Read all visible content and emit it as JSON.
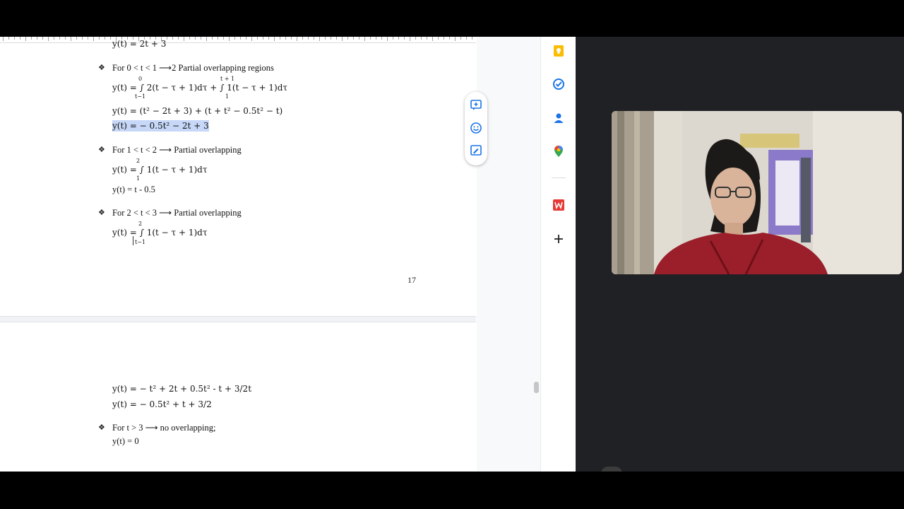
{
  "page1": {
    "top_line": "y(t) = 2t + 3",
    "bullet1": {
      "heading": "For 0 < t < 1 ⟶2  Partial overlapping regions",
      "eq1": "y(t) = ∫ 2(t − τ + 1)dτ + ∫ 1(t − τ + 1)dτ",
      "eq1_upper1": "0",
      "eq1_lower1": "t−1",
      "eq1_upper2": "t + 1",
      "eq1_lower2": "1",
      "eq2": "y(t) = (t² − 2t + 3) + (t + t² − 0.5t² − t)",
      "eq3": "y(t) = − 0.5t² − 2t + 3"
    },
    "bullet2": {
      "heading": "For 1 < t < 2  ⟶ Partial overlapping",
      "eq1": "y(t) = ∫ 1(t − τ + 1)dτ",
      "eq1_upper": "2",
      "eq1_lower": "1",
      "eq2": "y(t) = t - 0.5"
    },
    "bullet3": {
      "heading": "For 2 < t < 3  ⟶ Partial overlapping",
      "eq1": "y(t) = ∫ 1(t − τ + 1)dτ",
      "eq1_upper": "2",
      "eq1_lower": "t−1"
    },
    "page_number": "17"
  },
  "page2": {
    "eq1": "y(t) = − t² + 2t + 0.5t² - t + 3/2t",
    "eq2": "y(t) = − 0.5t² + t + 3/2",
    "bullet4": {
      "heading": "For t > 3 ⟶ no overlapping;",
      "eq1": "y(t) = 0"
    }
  },
  "bullet_glyph": "❖",
  "side_panel": {
    "icons": [
      "keep-icon",
      "tasks-icon",
      "contacts-icon",
      "maps-icon",
      "wps-icon",
      "add-icon"
    ]
  },
  "float_toolbar": {
    "icons": [
      "add-comment-icon",
      "emoji-icon",
      "suggest-edit-icon"
    ]
  },
  "colors": {
    "highlight": "#c7d7f7",
    "accent": "#1a73e8",
    "keep": "#fbbc04",
    "wps": "#e53935",
    "dark_bg": "#202124"
  }
}
